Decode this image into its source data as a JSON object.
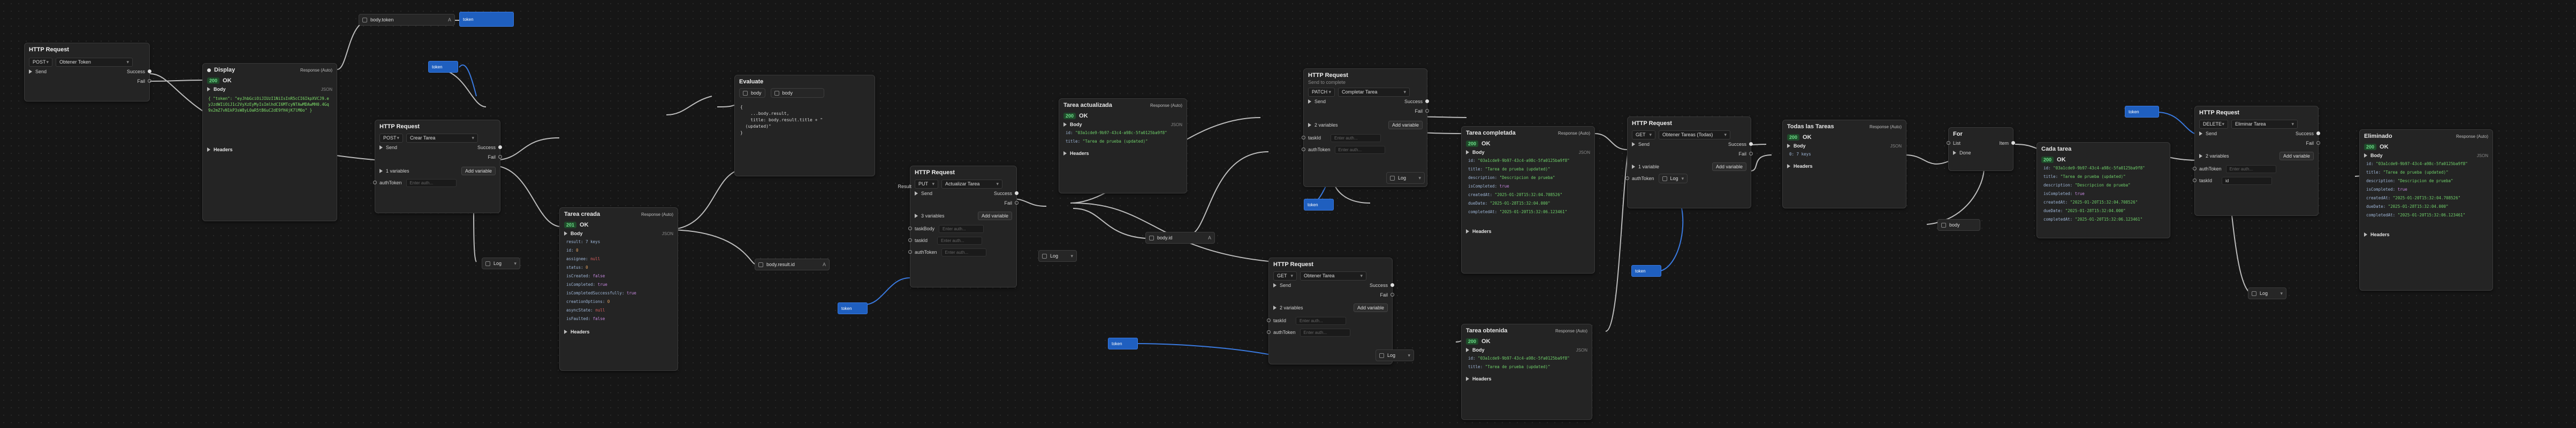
{
  "nodes": {
    "get_token": {
      "title": "HTTP Request",
      "method": "POST",
      "action": "Obtener Token",
      "send": "Send",
      "success": "Success",
      "fail": "Fail"
    },
    "display": {
      "title": "Display",
      "response_mode": "Response (Auto)",
      "status": "200",
      "status_text": "OK",
      "body_label": "Body",
      "body_format": "JSON",
      "body_text": "{ \"token\": \"eyJhbGciOiJIUzI1NiIsInR5cCI6IkpXVCJ9.eyJzdWIiOiJ1c2VyXzEyMyIsImlhdCI6MTcyNTAwMDAwMH0.4Gq9x2mZ7vN1kP3sW8yL0aR5tB6uC2dE9fH4jK7lM0o\" }",
      "headers_label": "Headers"
    },
    "body_token": {
      "label": "body.token",
      "arrow": "A"
    },
    "create_req": {
      "title": "HTTP Request",
      "method": "POST",
      "action": "Crear Tarea",
      "send": "Send",
      "success": "Success",
      "fail": "Fail",
      "vars": "1 variables",
      "add_var": "Add variable",
      "auth_label": "authToken",
      "auth_placeholder": "Enter auth..."
    },
    "created": {
      "title": "Tarea creada",
      "response_mode": "Response (Auto)",
      "status": "201",
      "status_text": "OK",
      "body_label": "Body",
      "body_format": "JSON",
      "obj_label": "result: 7 keys",
      "headers_label": "Headers"
    },
    "evaluate": {
      "title": "Evaluate",
      "input_label": "body",
      "field_label": "body",
      "code": "{\n    ...body.result,\n    title: body.result.title + \"\n  (updated)\"\n}"
    },
    "body_result_id": {
      "label": "body.result.id",
      "arrow": "A"
    },
    "update_req": {
      "title": "HTTP Request",
      "method": "PUT",
      "action": "Actualizar Tarea",
      "send": "Send",
      "success": "Success",
      "fail": "Fail",
      "result_label": "Result",
      "vars": "3 variables",
      "add_var": "Add variable",
      "task_body": "taskBody",
      "task_id": "taskId",
      "auth_label": "authToken",
      "placeholder": "Enter auth..."
    },
    "updated": {
      "title": "Tarea actualizada",
      "response_mode": "Response (Auto)",
      "status": "200",
      "status_text": "OK",
      "body_label": "Body",
      "body_format": "JSON",
      "id_value": "\"03a1cde9-9b97-43c4-a98c-5fa0125ba9f8\"",
      "title_value": "\"Tarea de prueba (updated)\"",
      "headers_label": "Headers"
    },
    "body_id": {
      "label": "body.id",
      "arrow": "A"
    },
    "complete_req": {
      "title": "HTTP Request",
      "subtitle": "Send to complete",
      "method": "PATCH",
      "action": "Completar Tarea",
      "send": "Send",
      "success": "Success",
      "fail": "Fail",
      "vars": "2 variables",
      "add_var": "Add variable",
      "task_id": "taskId",
      "auth_label": "authToken",
      "placeholder": "Enter auth..."
    },
    "completed": {
      "title": "Tarea completada",
      "response_mode": "Response (Auto)",
      "status": "200",
      "status_text": "OK",
      "body_label": "Body",
      "body_format": "JSON",
      "headers_label": "Headers",
      "fields": [
        {
          "k": "id:",
          "v": "\"03a1cde9-9b97-43c4-a98c-5fa0125ba9f8\"",
          "t": "s"
        },
        {
          "k": "title:",
          "v": "\"Tarea de prueba (updated)\"",
          "t": "s"
        },
        {
          "k": "description:",
          "v": "\"Descripcion de prueba\"",
          "t": "s"
        },
        {
          "k": "isCompleted:",
          "v": "true",
          "t": "b"
        },
        {
          "k": "createdAt:",
          "v": "\"2025-01-20T15:32:04.708526\"",
          "t": "s"
        },
        {
          "k": "dueDate:",
          "v": "\"2025-01-28T15:32:04.000\"",
          "t": "s"
        },
        {
          "k": "completedAt:",
          "v": "\"2025-01-20T15:32:06.123461\"",
          "t": "s"
        }
      ]
    },
    "get_req": {
      "title": "HTTP Request",
      "method": "GET",
      "action": "Obtener Tarea",
      "send": "Send",
      "success": "Success",
      "fail": "Fail",
      "vars": "2 variables",
      "add_var": "Add variable",
      "task_id": "taskId",
      "auth_label": "authToken",
      "placeholder": "Enter auth..."
    },
    "obtained": {
      "title": "Tarea obtenida",
      "response_mode": "Response (Auto)",
      "status": "200",
      "status_text": "OK",
      "body_label": "Body",
      "body_format": "JSON",
      "id_value": "\"03a1cde9-9b97-43c4-a98c-5fa0125ba9f8\"",
      "title_value": "\"Tarea de prueba (updated)\"",
      "headers_label": "Headers"
    },
    "all_req": {
      "title": "HTTP Request",
      "method": "GET",
      "action": "Obtener Tareas (Todas)",
      "send": "Send",
      "success": "Success",
      "fail": "Fail",
      "vars": "1 variable",
      "add_var": "Add variable",
      "auth_label": "authToken",
      "placeholder": "Enter auth..."
    },
    "all_tasks": {
      "title": "Todas las Tareas",
      "response_mode": "Response (Auto)",
      "status": "200",
      "status_text": "OK",
      "body_label": "Body",
      "body_format": "JSON",
      "obj_label": "0: 7 keys",
      "headers_label": "Headers"
    },
    "for": {
      "title": "For",
      "list_label": "List",
      "item_label": "Item",
      "done_label": "Done",
      "body_label": "body"
    },
    "each_task": {
      "title": "Cada tarea",
      "status": "200",
      "status_text": "OK",
      "fields": [
        {
          "k": "id:",
          "v": "\"03a1cde9-9b97-43c4-a98c-5fa0125ba9f8\"",
          "t": "s"
        },
        {
          "k": "title:",
          "v": "\"Tarea de prueba (updated)\"",
          "t": "s"
        },
        {
          "k": "description:",
          "v": "\"Descripcion de prueba\"",
          "t": "s"
        },
        {
          "k": "isCompleted:",
          "v": "true",
          "t": "b"
        },
        {
          "k": "createdAt:",
          "v": "\"2025-01-20T15:32:04.708526\"",
          "t": "s"
        },
        {
          "k": "dueDate:",
          "v": "\"2025-01-28T15:32:04.000\"",
          "t": "s"
        },
        {
          "k": "completedAt:",
          "v": "\"2025-01-20T15:32:06.123461\"",
          "t": "s"
        }
      ]
    },
    "delete_req": {
      "title": "HTTP Request",
      "method": "DELETE",
      "action": "Eliminar Tarea",
      "send": "Send",
      "success": "Success",
      "fail": "Fail",
      "vars": "2 variables",
      "add_var": "Add variable",
      "task_id": "taskId",
      "id_label": "id",
      "auth_label": "authToken",
      "placeholder": "Enter auth..."
    },
    "deleted": {
      "title": "Eliminado",
      "response_mode": "Response (Auto)",
      "status": "200",
      "status_text": "OK",
      "body_label": "Body",
      "body_format": "JSON",
      "headers_label": "Headers",
      "fields": [
        {
          "k": "id:",
          "v": "\"03a1cde9-9b97-43c4-a98c-5fa0125ba9f8\"",
          "t": "s"
        },
        {
          "k": "title:",
          "v": "\"Tarea de prueba (updated)\"",
          "t": "s"
        },
        {
          "k": "description:",
          "v": "\"Descripcion de prueba\"",
          "t": "s"
        },
        {
          "k": "isCompleted:",
          "v": "true",
          "t": "b"
        },
        {
          "k": "createdAt:",
          "v": "\"2025-01-20T15:32:04.708526\"",
          "t": "s"
        },
        {
          "k": "dueDate:",
          "v": "\"2025-01-28T15:32:04.000\"",
          "t": "s"
        },
        {
          "k": "completedAt:",
          "v": "\"2025-01-20T15:32:06.123461\"",
          "t": "s"
        }
      ]
    }
  },
  "created_fields": [
    {
      "k": "id:",
      "v": "0",
      "t": "n"
    },
    {
      "k": "assignee:",
      "v": "null",
      "t": "null"
    },
    {
      "k": "status:",
      "v": "0",
      "t": "n"
    },
    {
      "k": "isCreated:",
      "v": "false",
      "t": "b"
    },
    {
      "k": "isCompleted:",
      "v": "true",
      "t": "b"
    },
    {
      "k": "isCompletedSuccessfully:",
      "v": "true",
      "t": "b"
    },
    {
      "k": "creationOptions:",
      "v": "0",
      "t": "n"
    },
    {
      "k": "asyncState:",
      "v": "null",
      "t": "null"
    },
    {
      "k": "isFaulted:",
      "v": "false",
      "t": "b"
    }
  ],
  "token_chip": {
    "label": "token"
  },
  "small_labels": {
    "token": "token",
    "log": "Log"
  },
  "colors": {
    "accent": "#1f5fbf",
    "ok": "#6ee08a",
    "string": "#6fd06a",
    "wire": "#bdbdbd"
  }
}
